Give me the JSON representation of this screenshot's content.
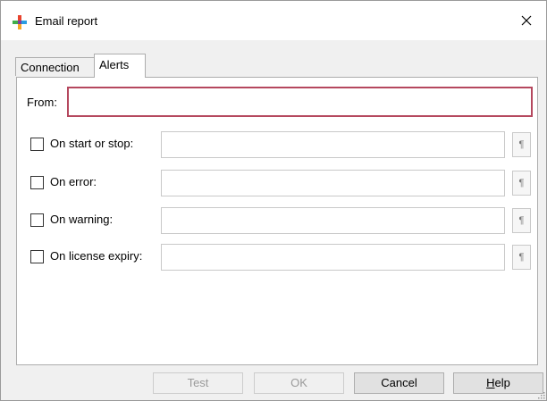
{
  "window": {
    "title": "Email report",
    "close_glyph": "✕",
    "app_icon": "colorful-plus-icon"
  },
  "tabs": [
    {
      "label": "Connection",
      "active": false
    },
    {
      "label": "Alerts",
      "active": true
    }
  ],
  "from": {
    "label": "From:",
    "value": "",
    "focus_border_color": "#b5485e"
  },
  "alerts": [
    {
      "label": "On start or stop:",
      "checked": false,
      "value": ""
    },
    {
      "label": "On error:",
      "checked": false,
      "value": ""
    },
    {
      "label": "On warning:",
      "checked": false,
      "value": ""
    },
    {
      "label": "On license expiry:",
      "checked": false,
      "value": ""
    }
  ],
  "pilcrow_glyph": "¶",
  "buttons": {
    "test": "Test",
    "ok": "OK",
    "cancel": "Cancel",
    "help_mnemonic": "H",
    "help_rest": "elp"
  }
}
